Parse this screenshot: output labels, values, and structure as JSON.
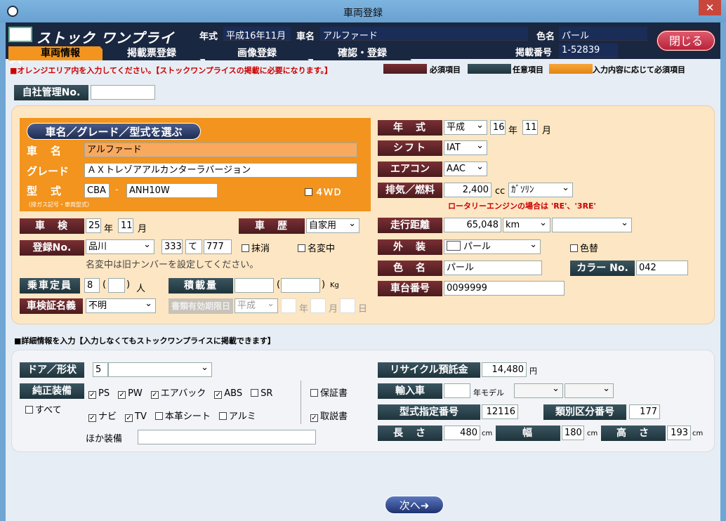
{
  "window": {
    "title": "車両登録"
  },
  "header": {
    "logo": "ストック ワンプライス",
    "year_label": "年式",
    "year_value": "平成16年11月",
    "name_label": "車名",
    "name_value": "アルファード",
    "color_label": "色名",
    "color_value": "パール",
    "close_button": "閉じる",
    "listing_label": "掲載番号",
    "listing_value": "1-52839"
  },
  "tabs": [
    "車両情報",
    "掲載票登録",
    "画像登録",
    "確認・登録"
  ],
  "notice": "■オレンジエリア内を入力してください。【ストックワンプライスの掲載に必要になります。】",
  "legend": {
    "required": "必須項目",
    "optional": "任意項目",
    "conditional": "入力内容に応じて必須項目"
  },
  "internal": {
    "label": "自社管理No.",
    "value": ""
  },
  "vehicle": {
    "choose_button": "車名／グレード／型式を選ぶ",
    "name_label": "車　名",
    "name_value": "アルファード",
    "grade_label": "グレード",
    "grade_value": "ＡＸトレゾアアルカンターラバージョン",
    "model_label": "型　式",
    "model_sub": "（排ガス記号・車両型式）",
    "model_prefix": "CBA",
    "model_sep": "-",
    "model_value": "ANH10W",
    "fourwd_label": "４ＷＤ"
  },
  "inspection": {
    "label": "車　検",
    "year": "25",
    "year_unit": "年",
    "month": "11",
    "month_unit": "月"
  },
  "history": {
    "label": "車　歴",
    "value": "自家用"
  },
  "registration": {
    "label": "登録No.",
    "area": "品川",
    "num1": "333",
    "kana": "て",
    "num2": "777",
    "cancel_label": "抹消",
    "rename_label": "名変中",
    "note": "名変中は旧ナンバーを設定してください。"
  },
  "capacity": {
    "label": "乗車定員",
    "value": "8",
    "paren_open": "(",
    "paren_close": ")",
    "sub": "",
    "unit": "人"
  },
  "load": {
    "label": "積載量",
    "value": "",
    "paren_open": "(",
    "paren_close": ")",
    "sub": "",
    "unit": "Kg"
  },
  "inspection_owner": {
    "label": "車検証名義",
    "value": "不明"
  },
  "doc_expiry": {
    "label": "書類有効期限日",
    "era": "平成",
    "year_unit": "年",
    "month_unit": "月",
    "day_unit": "日"
  },
  "specs": {
    "year_label": "年　式",
    "year_era": "平成",
    "year": "16",
    "year_unit": "年",
    "month": "11",
    "month_unit": "月",
    "shift_label": "シフト",
    "shift_value": "IAT",
    "ac_label": "エアコン",
    "ac_value": "AAC",
    "exhaust_label": "排気／燃料",
    "exhaust_value": "2,400",
    "exhaust_unit": "cc",
    "fuel_value": "ｶﾞｿﾘﾝ",
    "rotary_note": "ロータリーエンジンの場合は 'RE'、'3RE'",
    "mileage_label": "走行距離",
    "mileage_value": "65,048",
    "mileage_unit": "km",
    "mileage_extra": "",
    "exterior_label": "外　装",
    "exterior_value": "パール",
    "repaint_label": "色替",
    "colorname_label": "色　名",
    "colorname_value": "パール",
    "colorno_label": "カラー No.",
    "colorno_value": "042",
    "chassis_label": "車台番号",
    "chassis_value": "0099999"
  },
  "detail_notice": "■詳細情報を入力【入力しなくてもストックワンプライスに掲載できます】",
  "detail": {
    "door_label": "ドア／形状",
    "door_value": "5",
    "shape_value": "",
    "equip_label": "純正装備",
    "all_label": "すべて",
    "equip_items": [
      {
        "label": "PS",
        "checked": true
      },
      {
        "label": "PW",
        "checked": true
      },
      {
        "label": "エアバック",
        "checked": true
      },
      {
        "label": "ABS",
        "checked": true
      },
      {
        "label": "SR",
        "checked": false
      },
      {
        "label": "ナビ",
        "checked": true
      },
      {
        "label": "TV",
        "checked": true
      },
      {
        "label": "本革シート",
        "checked": false
      },
      {
        "label": "アルミ",
        "checked": false
      }
    ],
    "warranty_label": "保証書",
    "manual_label": "取説書",
    "other_label": "ほか装備",
    "other_value": "",
    "recycle_label": "リサイクル預託金",
    "recycle_value": "14,480",
    "recycle_unit": "円",
    "import_label": "輸入車",
    "import_value": "",
    "import_unit": "年モデル",
    "typeno_label": "型式指定番号",
    "typeno_value": "12116",
    "classno_label": "類別区分番号",
    "classno_value": "177",
    "length_label": "長　さ",
    "length_value": "480",
    "width_label": "幅",
    "width_value": "180",
    "height_label": "高　さ",
    "height_value": "193",
    "dim_unit": "cm"
  },
  "next_button": "次へ➜",
  "colors": {
    "accent": "#f2941d",
    "required": "#5a2226",
    "optional": "#2c444d",
    "header": "#1a2740"
  }
}
